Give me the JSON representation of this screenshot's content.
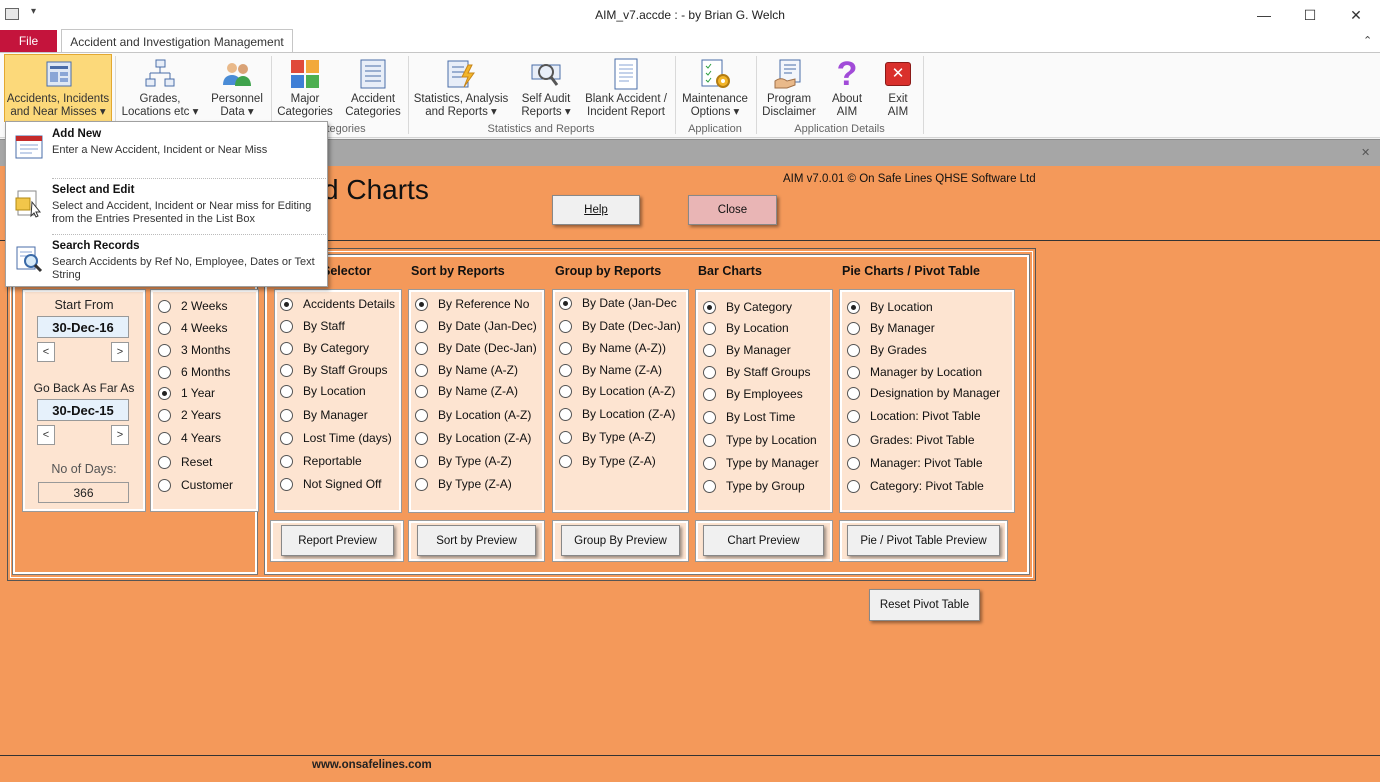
{
  "window": {
    "title": "AIM_v7.accde :  - by Brian G. Welch",
    "min_icon": "minimize-icon",
    "max_icon": "maximize-icon",
    "close_icon": "close-icon"
  },
  "tabs": {
    "file": "File",
    "active": "Accident and Investigation Management"
  },
  "ribbon": {
    "buttons": [
      {
        "l1": "Accidents, Incidents",
        "l2": "and Near Misses ▾"
      },
      {
        "l1": "Grades,",
        "l2": "Locations etc ▾"
      },
      {
        "l1": "Personnel",
        "l2": "Data ▾"
      },
      {
        "l1": "Major",
        "l2": "Categories"
      },
      {
        "l1": "Accident",
        "l2": "Categories"
      },
      {
        "l1": "Statistics, Analysis",
        "l2": "and Reports ▾"
      },
      {
        "l1": "Self Audit",
        "l2": "Reports ▾"
      },
      {
        "l1": "Blank Accident /",
        "l2": "Incident Report"
      },
      {
        "l1": "Maintenance",
        "l2": "Options ▾"
      },
      {
        "l1": "Program",
        "l2": "Disclaimer"
      },
      {
        "l1": "About",
        "l2": "AIM"
      },
      {
        "l1": "Exit",
        "l2": "AIM"
      }
    ],
    "groups": {
      "categories": "Categories",
      "stats": "Statistics and Reports",
      "application": "Application",
      "details": "Application Details"
    }
  },
  "menu": [
    {
      "title": "Add New",
      "desc": "Enter a New Accident, Incident or Near Miss"
    },
    {
      "title": "Select and Edit",
      "desc": "Select and Accident, Incident or Near miss for Editing from the Entries Presented in the List Box"
    },
    {
      "title": "Search Records",
      "desc": "Search Accidents by Ref No, Employee, Dates or Text String"
    }
  ],
  "form": {
    "title_visible": "d Charts",
    "version": "AIM v7.0.01 © On Safe Lines QHSE Software Ltd",
    "help": "Help",
    "close": "Close",
    "start_from_label": "Start From",
    "start_from": "30-Dec-16",
    "go_back_label": "Go Back As Far As",
    "go_back": "30-Dec-15",
    "no_days_label": "No of Days:",
    "no_days": "366",
    "prev": "<",
    "next": ">",
    "periods": [
      "2  Weeks",
      "4  Weeks",
      "3 Months",
      "6 Months",
      "1 Year",
      "2 Years",
      "4 Years",
      "Reset",
      "Customer"
    ],
    "period_selected": 4,
    "headers": {
      "selector": "Selector",
      "sort": "Sort by Reports",
      "group": "Group by Reports",
      "bar": "Bar Charts",
      "pie": "Pie Charts / Pivot Table"
    },
    "selector": [
      "Accidents Details",
      "By Staff",
      "By Category",
      "By Staff Groups",
      "By Location",
      "By Manager",
      "Lost Time (days)",
      "Reportable",
      "Not Signed Off"
    ],
    "sort": [
      "By Reference No",
      "By Date (Jan-Dec)",
      "By Date (Dec-Jan)",
      "By Name (A-Z)",
      "By Name (Z-A)",
      "By Location (A-Z)",
      "By Location (Z-A)",
      "By Type (A-Z)",
      "By Type (Z-A)"
    ],
    "group": [
      "By Date (Jan-Dec",
      "By Date (Dec-Jan)",
      "By Name (A-Z))",
      "By Name (Z-A)",
      "By Location (A-Z)",
      "By Location (Z-A)",
      "By Type (A-Z)",
      "By Type (Z-A)"
    ],
    "bar": [
      "By Category",
      "By Location",
      "By Manager",
      "By Staff Groups",
      "By Employees",
      "By Lost Time",
      "Type by Location",
      "Type by Manager",
      "Type by Group"
    ],
    "pie": [
      "By Location",
      "By Manager",
      "By Grades",
      "Manager by Location",
      "Designation by Manager",
      "Location: Pivot Table",
      "Grades: Pivot Table",
      "Manager: Pivot Table",
      "Category: Pivot Table"
    ],
    "report_preview": "Report Preview",
    "sort_preview": "Sort by Preview",
    "group_preview": "Group By Preview",
    "chart_preview": "Chart Preview",
    "pie_preview": "Pie / Pivot Table  Preview",
    "reset_pivot": "Reset Pivot Table"
  },
  "footer": "www.onsafelines.com"
}
